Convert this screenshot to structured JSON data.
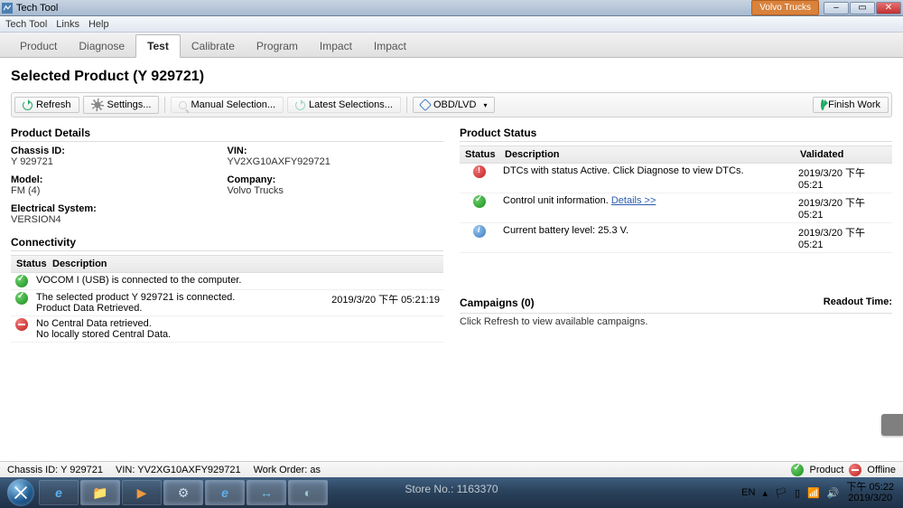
{
  "window": {
    "title": "Tech Tool",
    "orange_btn": "Volvo Trucks"
  },
  "menu": {
    "items": [
      "Tech Tool",
      "Links",
      "Help"
    ]
  },
  "tabs": {
    "items": [
      "Product",
      "Diagnose",
      "Test",
      "Calibrate",
      "Program",
      "Impact",
      "Impact"
    ],
    "active_index": 2
  },
  "heading": "Selected Product (Y 929721)",
  "toolbar": {
    "refresh": "Refresh",
    "settings": "Settings...",
    "manual": "Manual Selection...",
    "latest": "Latest Selections...",
    "conn": "OBD/LVD",
    "finish": "Finish Work"
  },
  "details": {
    "section": "Product Details",
    "chassis_label": "Chassis ID:",
    "chassis_value": "Y 929721",
    "vin_label": "VIN:",
    "vin_value": "YV2XG10AXFY929721",
    "model_label": "Model:",
    "model_value": "FM (4)",
    "company_label": "Company:",
    "company_value": "Volvo Trucks",
    "elec_label": "Electrical System:",
    "elec_value": "VERSION4"
  },
  "connectivity": {
    "section": "Connectivity",
    "h_status": "Status",
    "h_desc": "Description",
    "rows": [
      {
        "icon": "ok",
        "desc": "VOCOM I (USB) is connected to the computer.",
        "ts": ""
      },
      {
        "icon": "ok",
        "desc": "The selected product Y 929721 is connected.\nProduct Data Retrieved.",
        "ts": "2019/3/20 下午 05:21:19"
      },
      {
        "icon": "minus",
        "desc": "No Central Data retrieved.\nNo locally stored Central Data.",
        "ts": ""
      }
    ]
  },
  "status": {
    "section": "Product Status",
    "h_status": "Status",
    "h_desc": "Description",
    "h_val": "Validated",
    "rows": [
      {
        "icon": "err",
        "desc": "DTCs with status Active. Click Diagnose to view DTCs.",
        "val": "2019/3/20 下午 05:21",
        "link": ""
      },
      {
        "icon": "ok",
        "desc": "Control unit information.",
        "link": "Details >>",
        "val": "2019/3/20 下午 05:21"
      },
      {
        "icon": "info",
        "desc": "Current battery level: 25.3 V.",
        "link": "",
        "val": "2019/3/20 下午 05:21"
      }
    ]
  },
  "campaigns": {
    "section": "Campaigns  (0)",
    "readout_label": "Readout Time:",
    "hint": "Click Refresh to view available campaigns."
  },
  "statusbar": {
    "chassis": "Chassis ID: Y 929721",
    "vin": "VIN: YV2XG10AXFY929721",
    "order": "Work Order: as",
    "product": "Product",
    "offline": "Offline"
  },
  "taskbar": {
    "lang": "EN",
    "time": "下午 05:22",
    "date": "2019/3/20"
  },
  "watermark": "Store No.: 1163370"
}
